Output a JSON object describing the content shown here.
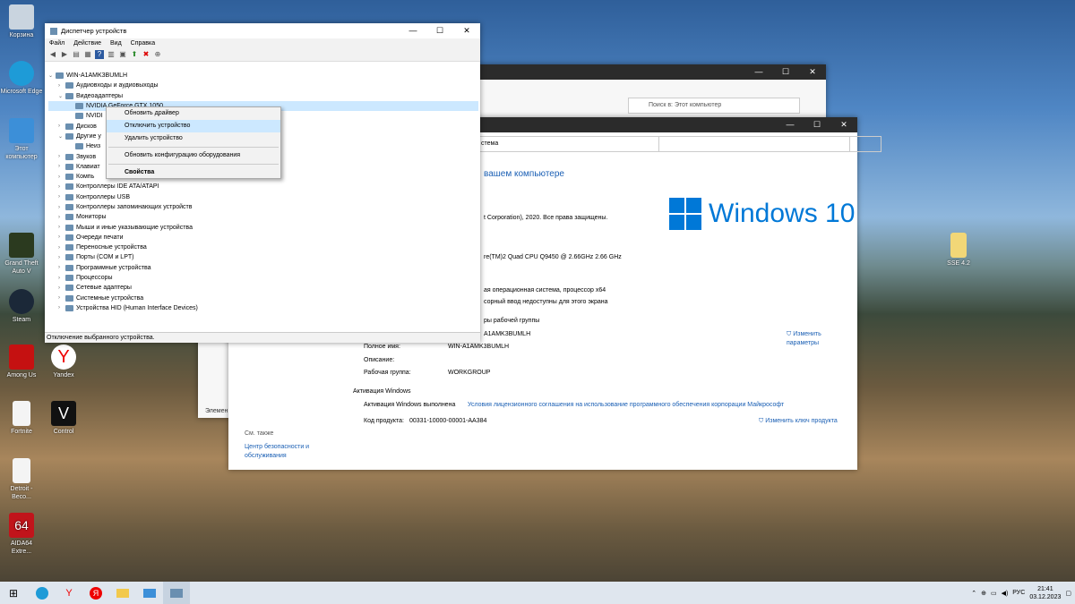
{
  "desktop": {
    "icons": [
      {
        "label": "Корзина"
      },
      {
        "label": "Microsoft Edge"
      },
      {
        "label": "Этот компьютер"
      },
      {
        "label": "Grand Theft Auto V"
      },
      {
        "label": "Steam"
      },
      {
        "label": "Among Us"
      },
      {
        "label": "Yandex"
      },
      {
        "label": "Fortnite"
      },
      {
        "label": "Control"
      },
      {
        "label": "Detroit - Beco..."
      },
      {
        "label": "AIDA64 Extre..."
      },
      {
        "label": "SSE 4.2"
      }
    ]
  },
  "device_manager": {
    "title": "Диспетчер устройств",
    "menu": [
      "Файл",
      "Действие",
      "Вид",
      "Справка"
    ],
    "tree": [
      {
        "label": "WIN-A1AMK3BUMLH",
        "level": 0,
        "exp": "⌄"
      },
      {
        "label": "Аудиовходы и аудиовыходы",
        "level": 1,
        "exp": "›"
      },
      {
        "label": "Видеоадаптеры",
        "level": 1,
        "exp": "⌄"
      },
      {
        "label": "NVIDIA GeForce GTX 1050",
        "level": 2,
        "exp": ""
      },
      {
        "label": "NVIDI",
        "level": 2,
        "exp": ""
      },
      {
        "label": "Дисков",
        "level": 1,
        "exp": "›"
      },
      {
        "label": "Другие у",
        "level": 1,
        "exp": "⌄"
      },
      {
        "label": "Неиз",
        "level": 2,
        "exp": ""
      },
      {
        "label": "Звуков",
        "level": 1,
        "exp": "›"
      },
      {
        "label": "Клавиат",
        "level": 1,
        "exp": "›"
      },
      {
        "label": "Компь",
        "level": 1,
        "exp": "›"
      },
      {
        "label": "Контроллеры IDE ATA/ATAPI",
        "level": 1,
        "exp": "›"
      },
      {
        "label": "Контроллеры USB",
        "level": 1,
        "exp": "›"
      },
      {
        "label": "Контроллеры запоминающих устройств",
        "level": 1,
        "exp": "›"
      },
      {
        "label": "Мониторы",
        "level": 1,
        "exp": "›"
      },
      {
        "label": "Мыши и иные указывающие устройства",
        "level": 1,
        "exp": "›"
      },
      {
        "label": "Очереди печати",
        "level": 1,
        "exp": "›"
      },
      {
        "label": "Переносные устройства",
        "level": 1,
        "exp": "›"
      },
      {
        "label": "Порты (COM и LPT)",
        "level": 1,
        "exp": "›"
      },
      {
        "label": "Программные устройства",
        "level": 1,
        "exp": "›"
      },
      {
        "label": "Процессоры",
        "level": 1,
        "exp": "›"
      },
      {
        "label": "Сетевые адаптеры",
        "level": 1,
        "exp": "›"
      },
      {
        "label": "Системные устройства",
        "level": 1,
        "exp": "›"
      },
      {
        "label": "Устройства HID (Human Interface Devices)",
        "level": 1,
        "exp": "›"
      }
    ],
    "status": "Отключение выбранного устройства."
  },
  "context_menu": {
    "items": [
      "Обновить драйвер",
      "Отключить устройство",
      "Удалить устройство",
      "Обновить конфигурацию оборудования",
      "Свойства"
    ]
  },
  "explorer": {
    "search_placeholder": "Поиск в: Этот компьютер",
    "side_text": "Элемен"
  },
  "system_window": {
    "address": "стема",
    "heading": "вашем компьютере",
    "copyright": "t Corporation), 2020. Все права защищены.",
    "brand": "Windows 10",
    "processor": "re(TM)2 Quad  CPU   Q9450  @ 2.66GHz   2.66 GHz",
    "os_type": "ая операционная система, процессор x64",
    "pen": "сорный ввод недоступны для этого экрана",
    "group_hdr": "ры рабочей группы",
    "computer_name": "A1AMK3BUMLH",
    "full_name_label": "Полное имя:",
    "full_name": "WIN-A1AMK3BUMLH",
    "desc_label": "Описание:",
    "workgroup_label": "Рабочая группа:",
    "workgroup": "WORKGROUP",
    "change_params": "Изменить параметры",
    "activation_hdr": "Активация Windows",
    "activation_text": "Активация Windows выполнена",
    "license_link": "Условия лицензионного соглашения на использование программного обеспечения корпорации Майкрософт",
    "product_label": "Код продукта:",
    "product_code": "00331-10000-00001-AA384",
    "change_key": "Изменить ключ продукта",
    "see_also": "См. также",
    "security": "Центр безопасности и обслуживания"
  },
  "taskbar": {
    "lang": "РУС",
    "time": "21:41",
    "date": "03.12.2023"
  }
}
